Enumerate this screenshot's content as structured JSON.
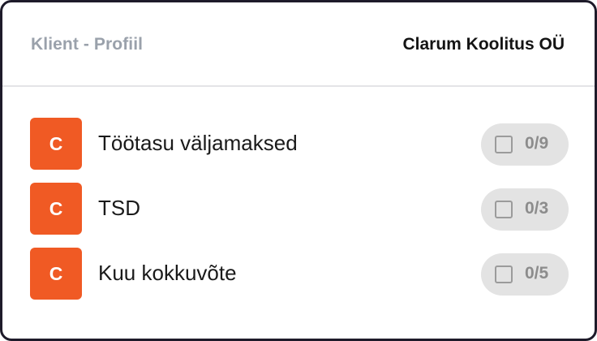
{
  "header": {
    "title": "Klient - Profiil",
    "company": "Clarum Koolitus OÜ"
  },
  "items": [
    {
      "avatar": "C",
      "label": "Töötasu väljamaksed",
      "count": "0/9",
      "checked": false
    },
    {
      "avatar": "C",
      "label": "TSD",
      "count": "0/3",
      "checked": false
    },
    {
      "avatar": "C",
      "label": "Kuu kokkuvõte",
      "count": "0/5",
      "checked": false
    }
  ],
  "colors": {
    "avatar_bg": "#f05a24",
    "pill_bg": "#e3e3e3",
    "border": "#1e1b2a"
  }
}
